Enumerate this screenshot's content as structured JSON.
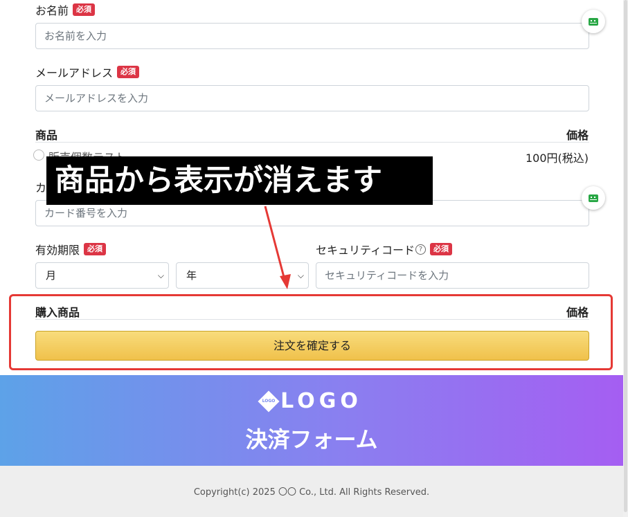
{
  "form": {
    "name": {
      "label": "お名前",
      "required": "必須",
      "placeholder": "お名前を入力"
    },
    "email": {
      "label": "メールアドレス",
      "required": "必須",
      "placeholder": "メールアドレスを入力"
    },
    "products": {
      "header_product": "商品",
      "header_price": "価格",
      "items": [
        {
          "name": "販売個数テスト",
          "price": "100円(税込)"
        }
      ]
    },
    "card": {
      "label": "カ",
      "placeholder": "カード番号を入力"
    },
    "expiry": {
      "label": "有効期限",
      "required": "必須",
      "month": "月",
      "year": "年"
    },
    "security": {
      "label": "セキュリティコード",
      "help_icon": "?",
      "required": "必須",
      "placeholder": "セキュリティコードを入力"
    },
    "purchase": {
      "header_product": "購入商品",
      "header_price": "価格"
    },
    "confirm_label": "注文を確定する"
  },
  "annotation": {
    "callout_text": "商品から表示が消えます",
    "color": "#e53935"
  },
  "banner": {
    "logo_mark": "LOGO",
    "logo_text": "LOGO",
    "title": "決済フォーム"
  },
  "footer": {
    "copyright": "Copyright(c) 2025 〇〇 Co., Ltd. All Rights Reserved."
  },
  "colors": {
    "required_badge": "#dc3545",
    "button": "#f0c14b",
    "fab_icon": "#28a745"
  },
  "icons": {
    "fab": "autofill-icon",
    "select": "chevron-down-icon",
    "help": "question-circle-icon"
  }
}
